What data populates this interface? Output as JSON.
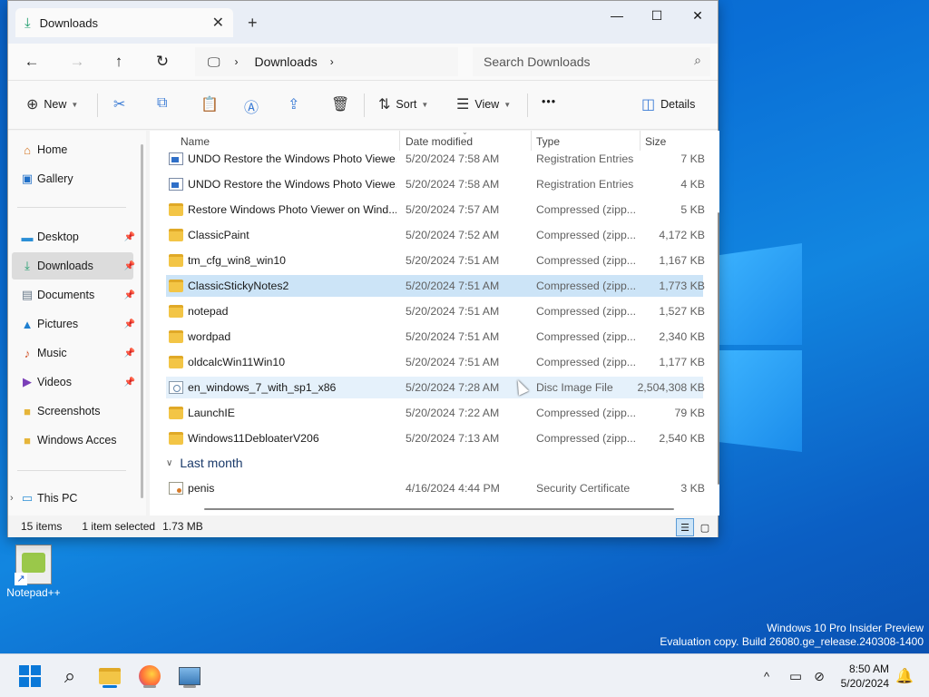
{
  "window": {
    "tab_title": "Downloads",
    "close_tab": "✕",
    "new_tab": "+",
    "minimize": "—",
    "maximize": "☐",
    "close": "✕"
  },
  "address": {
    "path": "Downloads",
    "search_placeholder": "Search Downloads"
  },
  "toolbar": {
    "new_label": "New",
    "sort_label": "Sort",
    "view_label": "View",
    "more_label": "•••",
    "details_label": "Details"
  },
  "nav": {
    "items": [
      {
        "label": "Home"
      },
      {
        "label": "Gallery"
      },
      {
        "label": "Desktop"
      },
      {
        "label": "Downloads"
      },
      {
        "label": "Documents"
      },
      {
        "label": "Pictures"
      },
      {
        "label": "Music"
      },
      {
        "label": "Videos"
      },
      {
        "label": "Screenshots"
      },
      {
        "label": "Windows Acces"
      },
      {
        "label": "This PC"
      }
    ]
  },
  "columns": {
    "name": "Name",
    "date": "Date modified",
    "type": "Type",
    "size": "Size"
  },
  "files": [
    {
      "name": "UNDO Restore the Windows Photo Viewe...",
      "date": "5/20/2024 7:58 AM",
      "type": "Registration Entries",
      "size": "7 KB",
      "icon": "reg"
    },
    {
      "name": "UNDO Restore the Windows Photo Viewe...",
      "date": "5/20/2024 7:58 AM",
      "type": "Registration Entries",
      "size": "4 KB",
      "icon": "reg"
    },
    {
      "name": "Restore Windows Photo Viewer on Wind...",
      "date": "5/20/2024 7:57 AM",
      "type": "Compressed (zipp...",
      "size": "5 KB",
      "icon": "folder"
    },
    {
      "name": "ClassicPaint",
      "date": "5/20/2024 7:52 AM",
      "type": "Compressed (zipp...",
      "size": "4,172 KB",
      "icon": "folder"
    },
    {
      "name": "tm_cfg_win8_win10",
      "date": "5/20/2024 7:51 AM",
      "type": "Compressed (zipp...",
      "size": "1,167 KB",
      "icon": "folder"
    },
    {
      "name": "ClassicStickyNotes2",
      "date": "5/20/2024 7:51 AM",
      "type": "Compressed (zipp...",
      "size": "1,773 KB",
      "icon": "folder"
    },
    {
      "name": "notepad",
      "date": "5/20/2024 7:51 AM",
      "type": "Compressed (zipp...",
      "size": "1,527 KB",
      "icon": "folder"
    },
    {
      "name": "wordpad",
      "date": "5/20/2024 7:51 AM",
      "type": "Compressed (zipp...",
      "size": "2,340 KB",
      "icon": "folder"
    },
    {
      "name": "oldcalcWin11Win10",
      "date": "5/20/2024 7:51 AM",
      "type": "Compressed (zipp...",
      "size": "1,177 KB",
      "icon": "folder"
    },
    {
      "name": "en_windows_7_with_sp1_x86",
      "date": "5/20/2024 7:28 AM",
      "type": "Disc Image File",
      "size": "2,504,308 KB",
      "icon": "iso"
    },
    {
      "name": "LaunchIE",
      "date": "5/20/2024 7:22 AM",
      "type": "Compressed (zipp...",
      "size": "79 KB",
      "icon": "folder"
    },
    {
      "name": "Windows11DebloaterV206",
      "date": "5/20/2024 7:13 AM",
      "type": "Compressed (zipp...",
      "size": "2,540 KB",
      "icon": "folder"
    }
  ],
  "group_last_month": "Last month",
  "last_month_files": [
    {
      "name": "penis",
      "date": "4/16/2024 4:44 PM",
      "type": "Security Certificate",
      "size": "3 KB",
      "icon": "cert"
    }
  ],
  "status": {
    "items_count": "15 items",
    "selection": "1 item selected",
    "selection_size": "1.73 MB"
  },
  "desktop": {
    "icon_label": "Notepad++",
    "watermark_line1": "Windows 10 Pro Insider Preview",
    "watermark_line2": "Evaluation copy. Build 26080.ge_release.240308-1400"
  },
  "taskbar": {
    "time": "8:50 AM",
    "date": "5/20/2024",
    "tray_chevron": "^"
  }
}
